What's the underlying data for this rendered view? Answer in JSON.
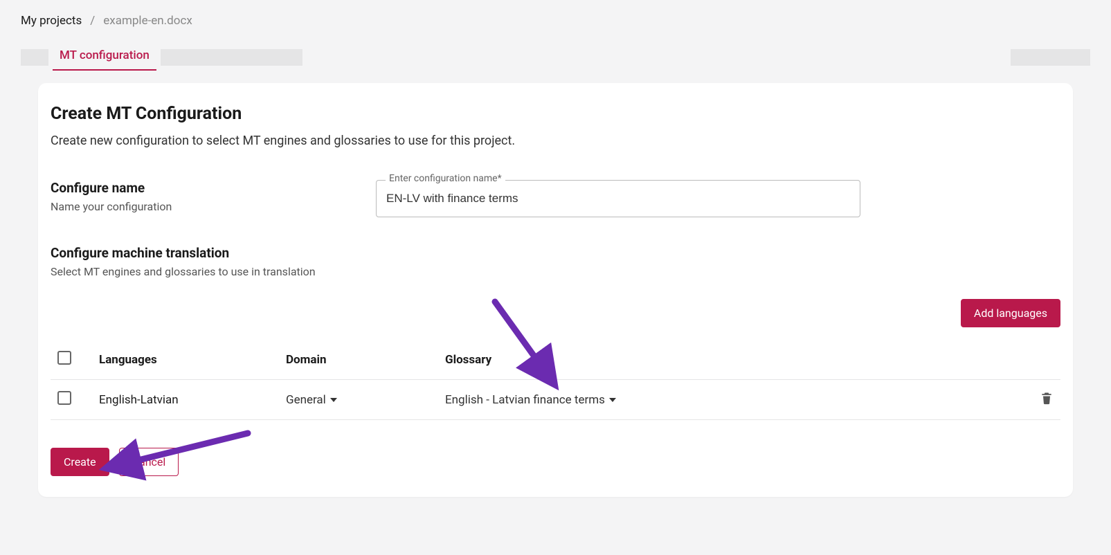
{
  "breadcrumb": {
    "root": "My projects",
    "sep": "/",
    "current": "example-en.docx"
  },
  "tabs": {
    "active": "MT configuration"
  },
  "header": {
    "title": "Create MT Configuration",
    "subtitle": "Create new configuration to select MT engines and glossaries to use for this project."
  },
  "config_name": {
    "title": "Configure name",
    "desc": "Name your configuration",
    "field_label": "Enter configuration name*",
    "value": "EN-LV with finance terms"
  },
  "mt_section": {
    "title": "Configure machine translation",
    "desc": "Select MT engines and glossaries to use in translation",
    "add_btn": "Add languages"
  },
  "table": {
    "headers": {
      "languages": "Languages",
      "domain": "Domain",
      "glossary": "Glossary"
    },
    "rows": [
      {
        "languages": "English-Latvian",
        "domain": "General",
        "glossary": "English - Latvian finance terms"
      }
    ]
  },
  "footer": {
    "create": "Create",
    "cancel": "Cancel"
  },
  "colors": {
    "accent": "#b9194b",
    "annotation": "#6b2bb0"
  }
}
